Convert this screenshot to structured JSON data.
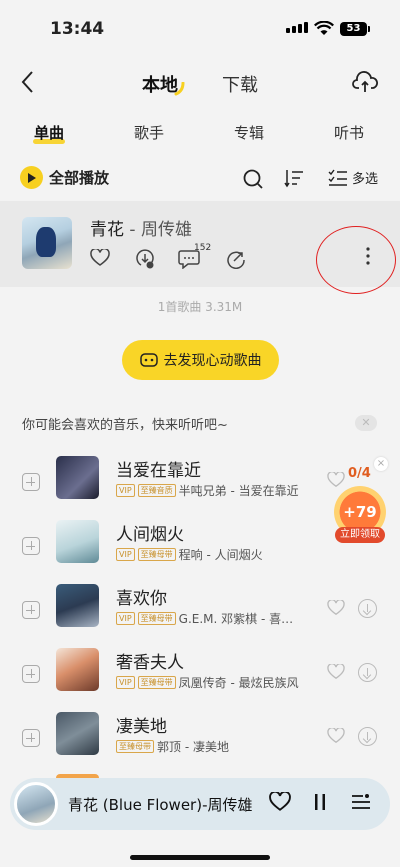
{
  "status": {
    "time": "13:44",
    "battery": "53"
  },
  "nav": {
    "tabs": [
      "本地",
      "下载"
    ]
  },
  "tabs": [
    "单曲",
    "歌手",
    "专辑",
    "听书"
  ],
  "controls": {
    "play_all": "全部播放",
    "multi_select": "多选"
  },
  "current": {
    "title": "青花",
    "separator": " - ",
    "artist": "周传雄",
    "comments": "152"
  },
  "summary": "1首歌曲 3.31M",
  "discover_label": "去发现心动歌曲",
  "recommend_title": "你可能会喜欢的音乐，快来听听吧~",
  "songs": [
    {
      "name": "当爱在靠近",
      "tags": [
        "VIP",
        "至臻音质"
      ],
      "detail": "半吨兄弟 - 当爱在靠近"
    },
    {
      "name": "人间烟火",
      "tags": [
        "VIP",
        "至臻母带"
      ],
      "detail": "程响 - 人间烟火"
    },
    {
      "name": "喜欢你",
      "tags": [
        "VIP",
        "至臻母带"
      ],
      "detail": "G.E.M. 邓紫棋 - 喜…"
    },
    {
      "name": "奢香夫人",
      "tags": [
        "VIP",
        "至臻母带"
      ],
      "detail": "凤凰传奇 - 最炫民族风"
    },
    {
      "name": "凄美地",
      "tags": [
        "至臻母带"
      ],
      "detail": "郭顶 - 凄美地"
    }
  ],
  "reward": {
    "progress": "0/4",
    "amount": "+79",
    "claim": "立即领取",
    "close": "×"
  },
  "player": {
    "title": "青花 (Blue Flower)-周传雄"
  },
  "colors": {
    "accent": "#f7d020",
    "highlight_circle": "#e02020"
  }
}
